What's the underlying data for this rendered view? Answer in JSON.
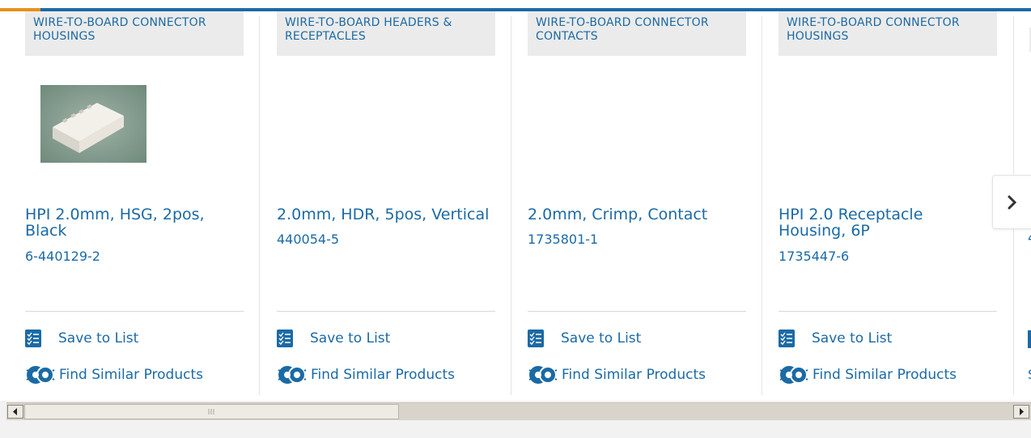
{
  "products": [
    {
      "category": "WIRE-TO-BOARD CONNECTOR HOUSINGS",
      "title": "HPI 2.0mm, HSG, 2pos, Black",
      "part_number": "6-440129-2",
      "has_image": true
    },
    {
      "category": "WIRE-TO-BOARD HEADERS & RECEPTACLES",
      "title": "2.0mm, HDR, 5pos, Vertical",
      "part_number": "440054-5",
      "has_image": false
    },
    {
      "category": "WIRE-TO-BOARD CONNECTOR CONTACTS",
      "title": "2.0mm, Crimp, Contact",
      "part_number": "1735801-1",
      "has_image": false
    },
    {
      "category": "WIRE-TO-BOARD CONNECTOR HOUSINGS",
      "title": "HPI 2.0 Receptacle Housing, 6P",
      "part_number": "1735447-6",
      "has_image": false
    }
  ],
  "actions": {
    "save_label": "Save to List",
    "find_label": "Find Similar Products"
  },
  "peek": {
    "title_fragment": "4",
    "find_fragment": "S"
  },
  "icons": {
    "save": "checklist-icon",
    "find": "similar-products-icon",
    "next": "chevron-right-icon",
    "scroll_left": "arrow-left-icon",
    "scroll_right": "arrow-right-icon"
  },
  "colors": {
    "brand_blue": "#1b6aa5",
    "accent_orange": "#e8901a"
  },
  "scroll": {
    "fraction_visible": 0.37,
    "position": 0
  }
}
